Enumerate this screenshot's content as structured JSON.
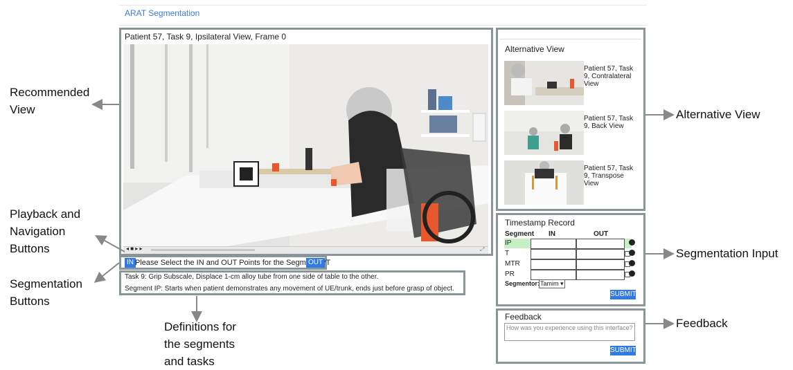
{
  "app": {
    "title": "ARAT Segmentation"
  },
  "main_view": {
    "title": "Patient 57, Task 9, Ipsilateral View, Frame 0",
    "controls_glyphs": "◂ ■ ▸ ▸"
  },
  "segmentation": {
    "in_label": "IN",
    "out_label": "OUT",
    "prompt": "Please Select the IN and OUT Points for the Segment IPT"
  },
  "definitions": {
    "task": "Task 9: Grip Subscale, Displace 1-cm alloy tube from one side of table to the other.",
    "segment": "Segment IP: Starts when patient demonstrates any movement of UE/trunk, ends just before grasp of object."
  },
  "alternative_view": {
    "header": "Alternative View",
    "items": [
      {
        "label": "Patient 57, Task 9, Contralateral View"
      },
      {
        "label": "Patient 57, Task 9, Back View"
      },
      {
        "label": "Patient 57, Task 9, Transpose View"
      }
    ]
  },
  "timestamp": {
    "header": "Timestamp Record",
    "columns": [
      "Segment",
      "IN",
      "OUT"
    ],
    "rows": [
      {
        "segment": "IP",
        "in": "",
        "out": ""
      },
      {
        "segment": "T",
        "in": "",
        "out": ""
      },
      {
        "segment": "MTR",
        "in": "",
        "out": ""
      },
      {
        "segment": "PR",
        "in": "",
        "out": ""
      }
    ],
    "segmentor_label": "Segmentor:",
    "segmentor_value": "Tamim",
    "submit_label": "SUBMIT",
    "active_row_color": "#c6efc6"
  },
  "feedback": {
    "header": "Feedback",
    "placeholder": "How was you experience using this interface?",
    "submit_label": "SUBMIT"
  },
  "annotations": {
    "recommended_view": [
      "Recommended",
      "View"
    ],
    "playback": [
      "Playback and",
      "Navigation",
      "Buttons"
    ],
    "segmentation_buttons": [
      "Segmentation",
      "Buttons"
    ],
    "definitions": [
      "Definitions for",
      "the segments",
      "and tasks"
    ],
    "alternative_view": "Alternative View",
    "segmentation_input": "Segmentation Input",
    "feedback": "Feedback"
  },
  "colors": {
    "accent": "#2f7ae5",
    "frame": "#8a9598"
  }
}
